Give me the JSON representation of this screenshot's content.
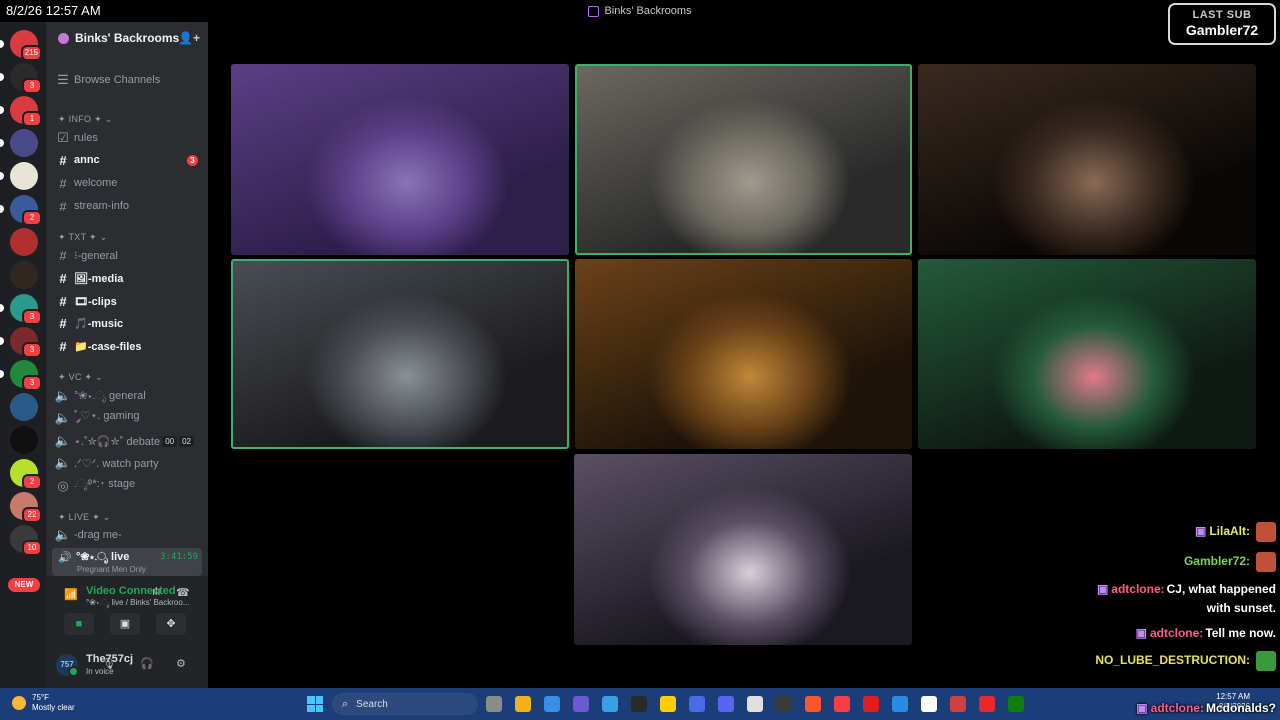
{
  "overlay": {
    "datetime": "8/2/26 12:57 AM",
    "last_sub_label": "LAST SUB",
    "last_sub_name": "Gambler72"
  },
  "window": {
    "title": "Binks' Backrooms"
  },
  "rail": {
    "servers": [
      {
        "badge": "215",
        "color": "#d83c3e"
      },
      {
        "badge": "3",
        "color": "#2a2a2a"
      },
      {
        "badge": "1",
        "color": "#d83c3e"
      },
      {
        "badge": "",
        "color": "#4a4a8a"
      },
      {
        "badge": "",
        "color": "#e8e4d8"
      },
      {
        "badge": "2",
        "color": "#3a5a9a"
      },
      {
        "badge": "",
        "color": "#b03030"
      },
      {
        "badge": "",
        "color": "#302820"
      },
      {
        "badge": "3",
        "color": "#2a9a8a"
      },
      {
        "badge": "3",
        "color": "#7a2a2a"
      },
      {
        "badge": "3",
        "color": "#1e8a3a"
      },
      {
        "badge": "",
        "color": "#2a5a8a"
      },
      {
        "badge": "",
        "color": "#111111"
      },
      {
        "badge": "2",
        "color": "#b7e02a"
      },
      {
        "badge": "22",
        "color": "#c87a6a"
      },
      {
        "badge": "10",
        "color": "#3a3a3a"
      }
    ],
    "new_label": "NEW"
  },
  "sidebar": {
    "server_name": "Binks' Backrooms",
    "browse": "Browse Channels",
    "cat_info": "✦ INFO ✦ ⌄",
    "rules": "rules",
    "annc": "annc",
    "annc_badge": "3",
    "welcome": "welcome",
    "stream_info": "stream-info",
    "cat_txt": "✦ TXT ✦ ⌄",
    "general": "⁝-general",
    "media": "🖼-media",
    "clips": "🎞-clips",
    "music": "🎵-music",
    "case_files": "📁-case-files",
    "cat_vc": "✦ VC ✦ ⌄",
    "vc_general": "°❀⋆.ೃ general",
    "vc_gaming": "˚ ༘♡⋆. gaming",
    "vc_debate": "⋆.˚✮🎧✮˚ debate",
    "debate_a": "00",
    "debate_b": "02",
    "vc_watch": ".ᐟ♡ᐟ. watch party",
    "vc_stage": ".ೃ࿔*:･ stage",
    "cat_live": "✦ LIVE ✦ ⌄",
    "drag_me": "-drag me-",
    "live_name": "°❀⋆.ೃ live",
    "live_time": "3:41:59",
    "live_sub": "Pregnant Men Only"
  },
  "voice": {
    "status": "Video Connected",
    "channel": "°❀⋆.ೃ live / Binks' Backroo...",
    "username": "The757cj",
    "user_status": "In voice",
    "avatar": "757"
  },
  "video_tiles": [
    {
      "name": "tile-1",
      "speaking": false,
      "palette": [
        "#2e1f4a",
        "#5a3f86",
        "#8a74b8"
      ]
    },
    {
      "name": "tile-2",
      "speaking": true,
      "palette": [
        "#2a2a2a",
        "#6b6860",
        "#a09a8e"
      ]
    },
    {
      "name": "tile-3",
      "speaking": false,
      "palette": [
        "#0a0806",
        "#3a2a20",
        "#8a6a54"
      ]
    },
    {
      "name": "tile-4",
      "speaking": true,
      "palette": [
        "#1c1c1e",
        "#4a4d54",
        "#8a9096"
      ]
    },
    {
      "name": "tile-5",
      "speaking": false,
      "palette": [
        "#1f1408",
        "#6a4218",
        "#c08838"
      ]
    },
    {
      "name": "tile-6",
      "speaking": false,
      "palette": [
        "#0e1a14",
        "#245a3a",
        "#e07a8a"
      ]
    },
    {
      "name": "tile-7",
      "speaking": false,
      "palette": [
        "#1a1820",
        "#5a5064",
        "#d8d0d8"
      ]
    }
  ],
  "chat": [
    {
      "user": "LilaAlt:",
      "msg": "",
      "color": "#e6e86a",
      "gift": true
    },
    {
      "user": "Gambler72:",
      "msg": "",
      "color": "#7bd84a",
      "gift": false
    },
    {
      "user": "adtclone:",
      "msg": "CJ, what happened",
      "color": "#ff5a8a",
      "gift": true
    },
    {
      "user": "",
      "msg": "with sunset.",
      "color": "#ffffff",
      "gift": false
    },
    {
      "user": "adtclone:",
      "msg": "Tell me now.",
      "color": "#ff5a8a",
      "gift": true
    },
    {
      "user": "NO_LUBE_DESTRUCTION:",
      "msg": "",
      "color": "#e8e05a",
      "gift": false
    },
    {
      "user": "adtclone:",
      "msg": "Mcdonalds?",
      "color": "#ff5a8a",
      "gift": true
    }
  ],
  "taskbar": {
    "temp": "75°F",
    "weather": "Mostly clear",
    "search": "Search",
    "time": "12:57 AM",
    "date": "8/2/2026",
    "apps": [
      "#8a8a8a",
      "#f2b01e",
      "#3a8ee6",
      "#6a5acd",
      "#3aa0e6",
      "#2a2a2a",
      "#ffcc00",
      "#4a6ae6",
      "#5865f2",
      "#e0e0e0",
      "#3a3a3a",
      "#fb542b",
      "#fc3c44",
      "#e01e1e",
      "#2a8ae6",
      "#ffffff",
      "#d04040",
      "#e8282c",
      "#107c10"
    ]
  }
}
